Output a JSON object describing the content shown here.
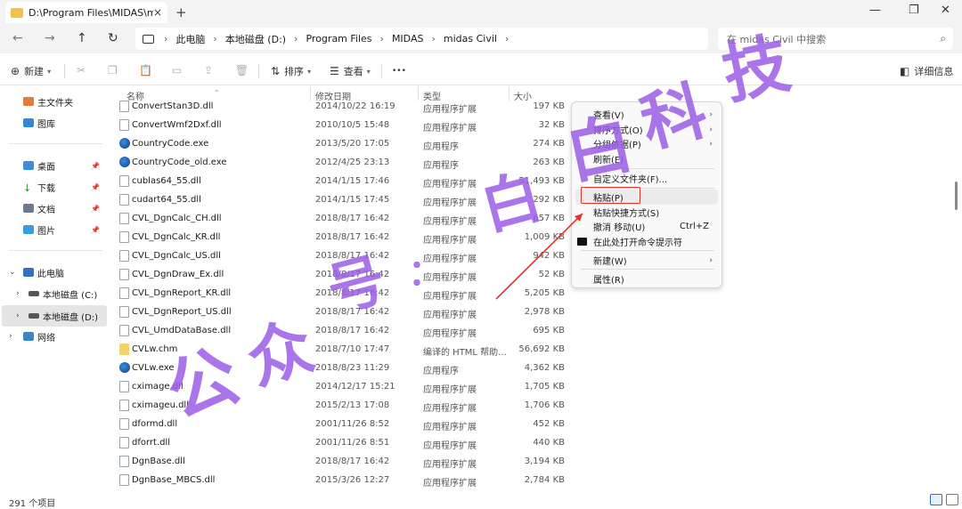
{
  "tab": {
    "title": "D:\\Program Files\\MIDAS\\mida",
    "close_icon": "×",
    "new_tab_icon": "+"
  },
  "window": {
    "minimize_icon": "—",
    "maximize_icon": "❐",
    "close_icon": "✕"
  },
  "nav": {
    "back_icon": "←",
    "forward_icon": "→",
    "up_icon": "↑",
    "refresh_icon": "↻"
  },
  "breadcrumb": [
    "此电脑",
    "本地磁盘 (D:)",
    "Program Files",
    "MIDAS",
    "midas Civil"
  ],
  "search": {
    "placeholder": "在 midas Civil 中搜索",
    "icon": "⌕"
  },
  "toolbar": {
    "new_label": "新建",
    "sort_label": "排序",
    "view_label": "查看",
    "more_icon": "•••",
    "details_label": "详细信息"
  },
  "sidebar": {
    "home": "主文件夹",
    "gallery": "图库",
    "desktop": "桌面",
    "downloads": "下载",
    "documents": "文档",
    "pictures": "图片",
    "this_pc": "此电脑",
    "drive_c": "本地磁盘 (C:)",
    "drive_d": "本地磁盘 (D:)",
    "network": "网络"
  },
  "columns": {
    "name": "名称",
    "date": "修改日期",
    "type": "类型",
    "size": "大小"
  },
  "files": [
    {
      "name": "ConvertStan3D.dll",
      "date": "2014/10/22 16:19",
      "type": "应用程序扩展",
      "size": "197 KB",
      "kind": "dll"
    },
    {
      "name": "ConvertWmf2Dxf.dll",
      "date": "2010/10/5 15:48",
      "type": "应用程序扩展",
      "size": "32 KB",
      "kind": "dll"
    },
    {
      "name": "CountryCode.exe",
      "date": "2013/5/20 17:05",
      "type": "应用程序",
      "size": "274 KB",
      "kind": "exe"
    },
    {
      "name": "CountryCode_old.exe",
      "date": "2012/4/25 23:13",
      "type": "应用程序",
      "size": "263 KB",
      "kind": "exe"
    },
    {
      "name": "cublas64_55.dll",
      "date": "2014/1/15 17:46",
      "type": "应用程序扩展",
      "size": "51,493 KB",
      "kind": "dll"
    },
    {
      "name": "cudart64_55.dll",
      "date": "2014/1/15 17:45",
      "type": "应用程序扩展",
      "size": "292 KB",
      "kind": "dll"
    },
    {
      "name": "CVL_DgnCalc_CH.dll",
      "date": "2018/8/17 16:42",
      "type": "应用程序扩展",
      "size": "657 KB",
      "kind": "dll"
    },
    {
      "name": "CVL_DgnCalc_KR.dll",
      "date": "2018/8/17 16:42",
      "type": "应用程序扩展",
      "size": "1,009 KB",
      "kind": "dll"
    },
    {
      "name": "CVL_DgnCalc_US.dll",
      "date": "2018/8/17 16:42",
      "type": "应用程序扩展",
      "size": "942 KB",
      "kind": "dll"
    },
    {
      "name": "CVL_DgnDraw_Ex.dll",
      "date": "2018/8/17 16:42",
      "type": "应用程序扩展",
      "size": "52 KB",
      "kind": "dll"
    },
    {
      "name": "CVL_DgnReport_KR.dll",
      "date": "2018/8/17 16:42",
      "type": "应用程序扩展",
      "size": "5,205 KB",
      "kind": "dll"
    },
    {
      "name": "CVL_DgnReport_US.dll",
      "date": "2018/8/17 16:42",
      "type": "应用程序扩展",
      "size": "2,978 KB",
      "kind": "dll"
    },
    {
      "name": "CVL_UmdDataBase.dll",
      "date": "2018/8/17 16:42",
      "type": "应用程序扩展",
      "size": "695 KB",
      "kind": "dll"
    },
    {
      "name": "CVLw.chm",
      "date": "2018/7/10 17:47",
      "type": "编译的 HTML 帮助...",
      "size": "56,692 KB",
      "kind": "chm"
    },
    {
      "name": "CVLw.exe",
      "date": "2018/8/23 11:29",
      "type": "应用程序",
      "size": "4,362 KB",
      "kind": "exe"
    },
    {
      "name": "cximage.dll",
      "date": "2014/12/17 15:21",
      "type": "应用程序扩展",
      "size": "1,705 KB",
      "kind": "dll"
    },
    {
      "name": "cximageu.dll",
      "date": "2015/2/13 17:08",
      "type": "应用程序扩展",
      "size": "1,706 KB",
      "kind": "dll"
    },
    {
      "name": "dformd.dll",
      "date": "2001/11/26 8:52",
      "type": "应用程序扩展",
      "size": "452 KB",
      "kind": "dll"
    },
    {
      "name": "dforrt.dll",
      "date": "2001/11/26 8:51",
      "type": "应用程序扩展",
      "size": "440 KB",
      "kind": "dll"
    },
    {
      "name": "DgnBase.dll",
      "date": "2018/8/17 16:42",
      "type": "应用程序扩展",
      "size": "3,194 KB",
      "kind": "dll"
    },
    {
      "name": "DgnBase_MBCS.dll",
      "date": "2015/3/26 12:27",
      "type": "应用程序扩展",
      "size": "2,784 KB",
      "kind": "dll"
    }
  ],
  "context_menu": {
    "view": "查看(V)",
    "sort": "排序方式(O)",
    "group": "分组依据(P)",
    "refresh": "刷新(E)",
    "customize": "自定义文件夹(F)...",
    "paste": "粘贴(P)",
    "paste_shortcut": "粘贴快捷方式(S)",
    "undo": "撤消 移动(U)",
    "undo_shortcut": "Ctrl+Z",
    "terminal": "在此处打开命令提示符",
    "new": "新建(W)",
    "properties": "属性(R)"
  },
  "watermark": "公众号：白白科技",
  "status": {
    "count": "291 个项目"
  },
  "colors": {
    "highlight_box": "#e0352b",
    "watermark": "#9b5de5",
    "arrow": "#e0352b"
  }
}
